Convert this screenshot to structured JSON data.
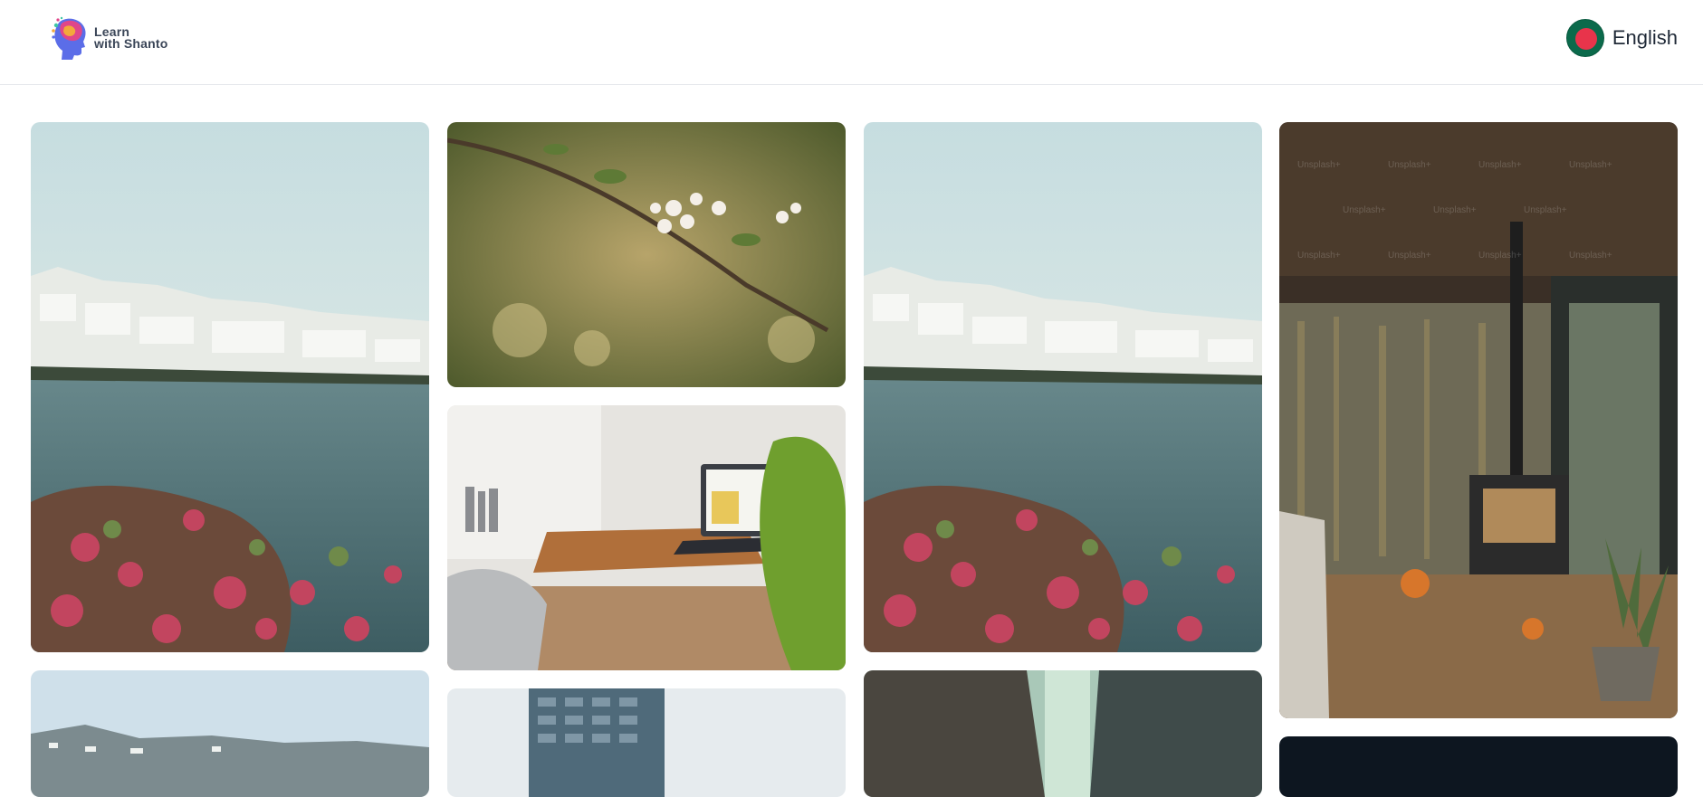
{
  "brand": {
    "line1": "Learn",
    "line2": "with Shanto",
    "logo_icon": "head-profile-icon"
  },
  "language": {
    "label": "English",
    "flag_icon": "bangladesh-flag-icon"
  },
  "gallery": {
    "images": [
      {
        "name": "gallery-image-coastal-village-1",
        "subject": "coastal-village"
      },
      {
        "name": "gallery-image-blossom-branch",
        "subject": "blossom-branch"
      },
      {
        "name": "gallery-image-coastal-village-2",
        "subject": "coastal-village"
      },
      {
        "name": "gallery-image-cabin-interior",
        "subject": "cabin-interior"
      },
      {
        "name": "gallery-image-laptop-desk",
        "subject": "laptop-desk"
      },
      {
        "name": "gallery-image-hillside-town",
        "subject": "hillside-town"
      },
      {
        "name": "gallery-image-tower-building",
        "subject": "tower-building"
      },
      {
        "name": "gallery-image-city-street",
        "subject": "city-street"
      },
      {
        "name": "gallery-image-dark-scene",
        "subject": "dark-scene"
      }
    ],
    "watermark": "Unsplash+"
  },
  "colors": {
    "flag_green": "#0b6a4b",
    "flag_red": "#e8344b",
    "header_border": "#e5e7eb"
  }
}
